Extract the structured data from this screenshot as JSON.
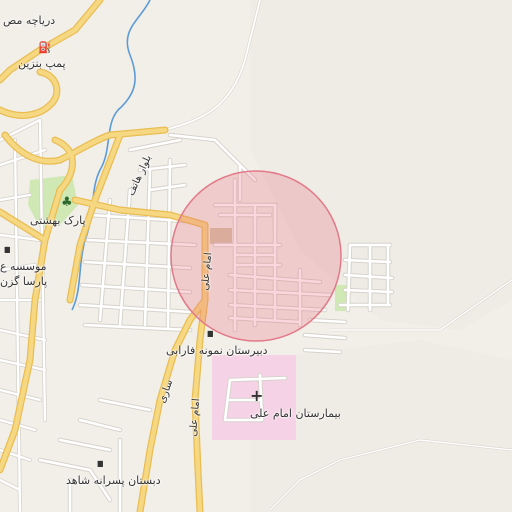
{
  "map": {
    "colors": {
      "land": "#f2efe9",
      "hills": "#ebe7e0",
      "road_major": "#f6d782",
      "road_major_casing": "#e9bd52",
      "road_minor": "#ffffff",
      "road_minor_casing": "#d6d2cb",
      "park": "#cfe8b4",
      "river": "#5b9bd8",
      "hospital": "#f6d2e6",
      "radius_fill": "rgba(232,110,130,0.28)",
      "radius_stroke": "#e27a88"
    },
    "labels": {
      "lake_view": "دریاچه مص",
      "gas_station": "پمپ بنزین",
      "park_name": "پارک بهشتی",
      "institute": "موسسه ع",
      "parsa": "پارسا گزن",
      "boulevard": "بلوار هاتف",
      "imam_ali_road_1": "امام علی",
      "imam_ali_road_2": "امام علی",
      "school_farabi": "دبیرستان نمونه فارابی",
      "hospital_name": "بیمارستان امام علی",
      "school_shahed": "دبستان پسرانه شاهد",
      "road_sari": "ساری"
    },
    "icons": {
      "gas": "⛽",
      "tree": "♣",
      "school": "▮▮",
      "hospital": "+"
    }
  }
}
